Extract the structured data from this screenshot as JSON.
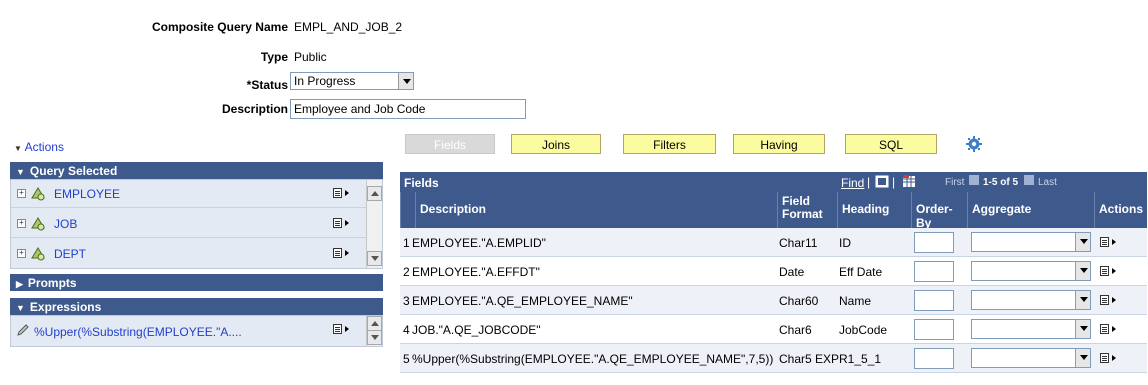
{
  "header": {
    "composite_query_name_label": "Composite Query Name",
    "composite_query_name_value": "EMPL_AND_JOB_2",
    "type_label": "Type",
    "type_value": "Public",
    "status_label": "*Status",
    "status_value": "In Progress",
    "description_label": "Description",
    "description_value": "Employee and Job Code"
  },
  "left": {
    "actions_label": "Actions",
    "query_selected_label": "Query Selected",
    "queries": [
      "EMPLOYEE",
      "JOB",
      "DEPT"
    ],
    "prompts_label": "Prompts",
    "expressions_label": "Expressions",
    "expression_item": "%Upper(%Substring(EMPLOYEE.\"A...."
  },
  "tabs": [
    {
      "label": "Fields",
      "active": false
    },
    {
      "label": "Joins",
      "active": true
    },
    {
      "label": "Filters",
      "active": true
    },
    {
      "label": "Having",
      "active": true
    },
    {
      "label": "SQL",
      "active": true
    }
  ],
  "grid": {
    "title": "Fields",
    "find": "Find",
    "pager_first": "First",
    "pager_range": "1-5 of 5",
    "pager_last": "Last",
    "columns": {
      "description": "Description",
      "field_format_1": "Field",
      "field_format_2": "Format",
      "heading": "Heading",
      "order_by": "Order-By",
      "aggregate": "Aggregate",
      "actions": "Actions"
    },
    "rows": [
      {
        "num": "1",
        "description": "EMPLOYEE.\"A.EMPLID\"",
        "format": "Char11",
        "heading": "ID"
      },
      {
        "num": "2",
        "description": "EMPLOYEE.\"A.EFFDT\"",
        "format": "Date",
        "heading": "Eff Date"
      },
      {
        "num": "3",
        "description": "EMPLOYEE.\"A.QE_EMPLOYEE_NAME\"",
        "format": "Char60",
        "heading": "Name"
      },
      {
        "num": "4",
        "description": "JOB.\"A.QE_JOBCODE\"",
        "format": "Char6",
        "heading": "JobCode"
      },
      {
        "num": "5",
        "description": "%Upper(%Substring(EMPLOYEE.\"A.QE_EMPLOYEE_NAME\",7,5))",
        "format": "Char5",
        "heading": "EXPR1_5_1"
      }
    ]
  },
  "colors": {
    "header_blue": "#3e5a8d",
    "tab_yellow": "#fbfba0",
    "link_blue": "#1f3fd0"
  }
}
